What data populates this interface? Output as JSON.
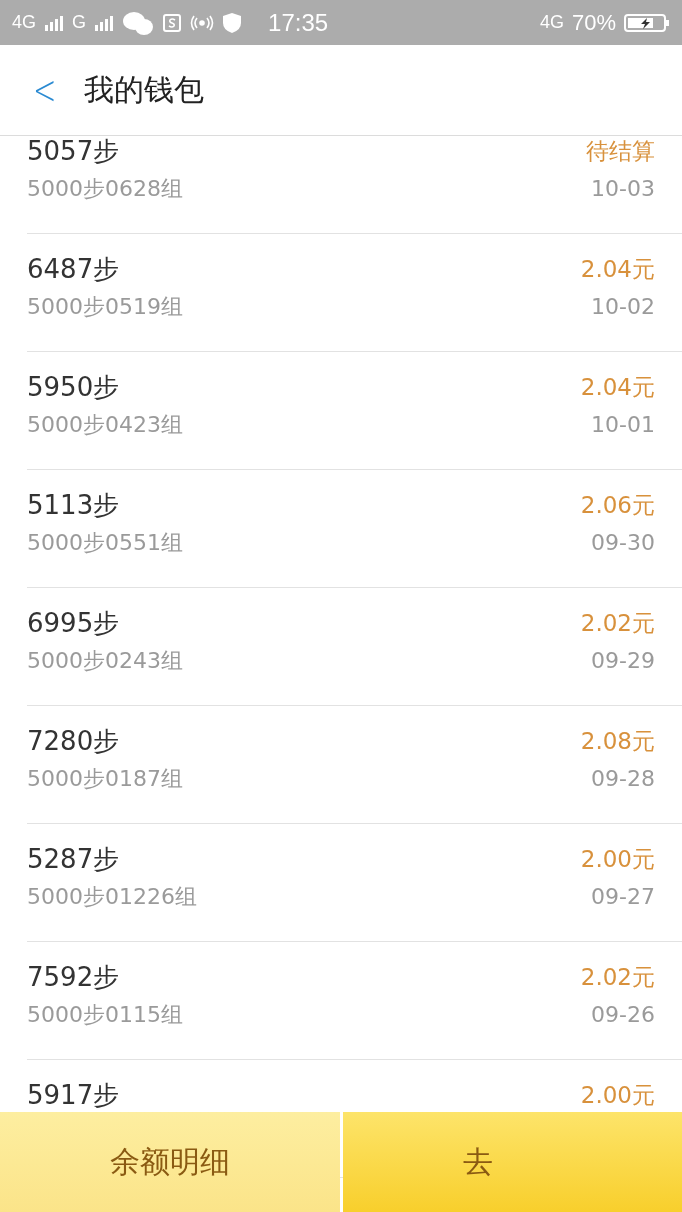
{
  "status_bar": {
    "network_1": "4G",
    "network_2": "G",
    "time": "17:35",
    "network_3": "4G",
    "battery": "70%"
  },
  "header": {
    "back": "<",
    "title": "我的钱包"
  },
  "records": [
    {
      "steps": "5057步",
      "group": "5000步0628组",
      "amount": "待结算",
      "date": "10-03"
    },
    {
      "steps": "6487步",
      "group": "5000步0519组",
      "amount": "2.04元",
      "date": "10-02"
    },
    {
      "steps": "5950步",
      "group": "5000步0423组",
      "amount": "2.04元",
      "date": "10-01"
    },
    {
      "steps": "5113步",
      "group": "5000步0551组",
      "amount": "2.06元",
      "date": "09-30"
    },
    {
      "steps": "6995步",
      "group": "5000步0243组",
      "amount": "2.02元",
      "date": "09-29"
    },
    {
      "steps": "7280步",
      "group": "5000步0187组",
      "amount": "2.08元",
      "date": "09-28"
    },
    {
      "steps": "5287步",
      "group": "5000步01226组",
      "amount": "2.00元",
      "date": "09-27"
    },
    {
      "steps": "7592步",
      "group": "5000步0115组",
      "amount": "2.02元",
      "date": "09-26"
    },
    {
      "steps": "5917步",
      "amount": "2.00元"
    }
  ],
  "bottom_buttons": [
    {
      "label": "余额明细",
      "kind": "light"
    },
    {
      "label": "去",
      "kind": "dark"
    }
  ]
}
